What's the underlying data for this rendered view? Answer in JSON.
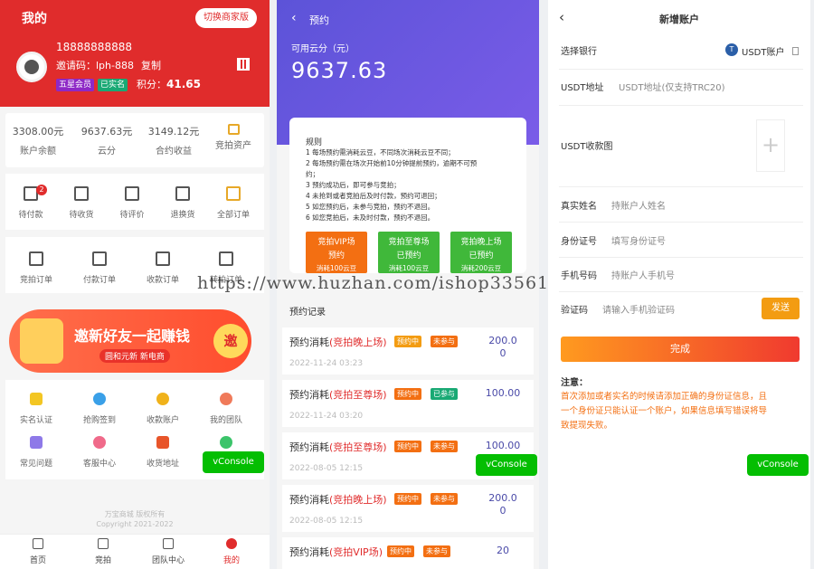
{
  "watermark": "https://www.huzhan.com/ishop33561",
  "p1": {
    "title": "我的",
    "switch_label": "切换商家版",
    "phone": "18888888888",
    "invite": "邀请码：lph-888",
    "copy": "复制",
    "tag_vip": "五星会员",
    "tag_verified": "已实名",
    "points_label": "积分：",
    "points_value": "41.65",
    "assets": [
      {
        "value": "3308.00元",
        "label": "账户余额"
      },
      {
        "value": "9637.63元",
        "label": "云分"
      },
      {
        "value": "3149.12元",
        "label": "合约收益"
      },
      {
        "value": "",
        "label": "竞拍资产"
      }
    ],
    "orders": [
      {
        "label": "待付款",
        "badge": "2"
      },
      {
        "label": "待收货"
      },
      {
        "label": "待评价"
      },
      {
        "label": "退换货"
      },
      {
        "label": "全部订单"
      }
    ],
    "orders2": [
      "竞拍订单",
      "付款订单",
      "收款订单",
      "转拍订单"
    ],
    "banner_main": "邀新好友一起赚钱",
    "banner_sub": "圆和元新 新电商",
    "banner_round": "邀",
    "services": [
      "实名认证",
      "抢购签到",
      "收款账户",
      "我的团队",
      "常见问题",
      "客服中心",
      "收货地址",
      ""
    ],
    "vconsole": "vConsole",
    "company": "万宝商城 版权所有",
    "copyright": "Copyright 2021-2022",
    "tabs": [
      "首页",
      "竞拍",
      "团队中心",
      "我的"
    ]
  },
  "p2": {
    "title": "预约",
    "cloud_label": "可用云分（元）",
    "cloud_value": "9637.63",
    "rules_title": "规则",
    "rules": [
      "1 每场预约需消耗云豆，不同场次消耗云豆不同；",
      "2 每场预约需在场次开始前10分钟提前预约，逾期不可预",
      "约；",
      "3 预约成功后，即可参与竞拍；",
      "4 未抢到或者竞拍后及时付款，预约可退回；",
      "5 如您预约后，未参与竞拍，预约不退回。",
      "6 如您竞拍后，未及时付款，预约不退回。"
    ],
    "bids": [
      {
        "name": "竞拍VIP场",
        "status": "预约",
        "cost": "消耗100云豆",
        "color": "#f36f12"
      },
      {
        "name": "竞拍至尊场",
        "status": "已预约",
        "cost": "消耗100云豆",
        "color": "#40b83a"
      },
      {
        "name": "竞拍晚上场",
        "status": "已预约",
        "cost": "消耗200云豆",
        "color": "#40b83a"
      }
    ],
    "records_title": "预约记录",
    "records": [
      {
        "prefix": "预约消耗",
        "name": "(竞拍晚上场)",
        "t1": "预约中",
        "t2": "未参与",
        "t2kind": "b",
        "amount": "200.0 0",
        "time": "2022-11-24 03:23"
      },
      {
        "prefix": "预约消耗",
        "name": "(竞拍至尊场)",
        "t1": "预约中",
        "t2": "已参与",
        "t2kind": "c",
        "amount": "100.00",
        "time": "2022-11-24 03:20"
      },
      {
        "prefix": "预约消耗",
        "name": "(竞拍至尊场)",
        "t1": "预约中",
        "t2": "未参与",
        "t2kind": "b",
        "amount": "100.00",
        "time": "2022-08-05 12:15"
      },
      {
        "prefix": "预约消耗",
        "name": "(竞拍晚上场)",
        "t1": "预约中",
        "t2": "未参与",
        "t2kind": "b",
        "amount": "200.0 0",
        "time": "2022-08-05 12:15"
      },
      {
        "prefix": "预约消耗",
        "name": "(竞拍VIP场)",
        "t1": "预约中",
        "t2": "未参与",
        "t2kind": "b",
        "amount": "20",
        "time": ""
      }
    ],
    "vconsole": "vConsole"
  },
  "p3": {
    "title": "新增账户",
    "bank_label": "选择银行",
    "bank_value": "USDT账户",
    "usdt_icon": "T",
    "addr_label": "USDT地址",
    "addr_placeholder": "USDT地址(仅支持TRC20)",
    "qr_label": "USDT收款图",
    "plus": "+",
    "name_label": "真实姓名",
    "name_placeholder": "持账户人姓名",
    "id_label": "身份证号",
    "id_placeholder": "填写身份证号",
    "mobile_label": "手机号码",
    "mobile_placeholder": "持账户人手机号",
    "code_label": "验证码",
    "code_placeholder": "请输入手机验证码",
    "send": "发送",
    "done": "完成",
    "notice_title": "注意：",
    "notice": [
      "首次添加或者实名的时候请添加正确的身份证信息，且",
      "一个身份证只能认证一个账户，如果信息填写错误将导",
      "致提现失败。"
    ],
    "vconsole": "vConsole"
  }
}
